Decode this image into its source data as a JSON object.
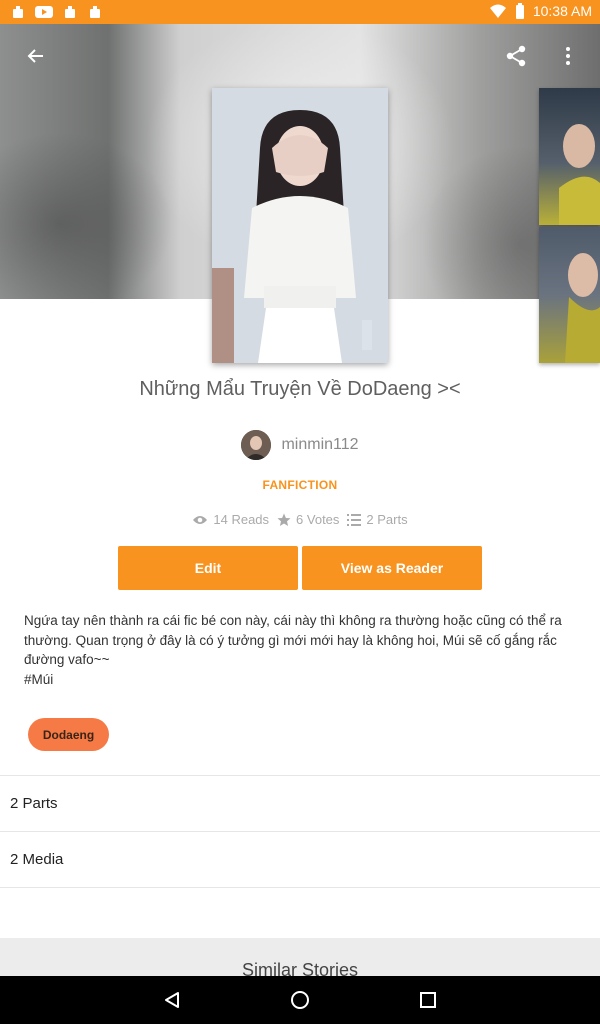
{
  "status_bar": {
    "time": "10:38 AM",
    "left_icons": [
      "notification-icon",
      "youtube-icon",
      "notification-icon",
      "notification-icon"
    ],
    "right_icons": [
      "wifi-icon",
      "battery-icon"
    ]
  },
  "header": {
    "icons": [
      "back-arrow-icon",
      "share-icon",
      "more-vert-icon"
    ]
  },
  "story": {
    "title": "Những Mẩu Truyện Về DoDaeng ><",
    "author": "minmin112",
    "category": "FANFICTION",
    "stats": {
      "reads": "14 Reads",
      "votes": "6 Votes",
      "parts": "2 Parts"
    },
    "actions": {
      "edit": "Edit",
      "view_as_reader": "View as Reader"
    },
    "description_lines": [
      "Ngứa tay nên thành ra cái fic bé con này, cái này thì không ra thường hoặc cũng có thể ra",
      "thường. Quan trọng ở đây là có ý tưởng gì mới mới hay là không hoi, Múi sẽ cố gắng rắc",
      "đường vafo~~",
      "#Múi"
    ],
    "tag": "Dodaeng"
  },
  "sections": {
    "parts": "2 Parts",
    "media": "2 Media",
    "similar": "Similar Stories"
  },
  "colors": {
    "accent": "#f7931e",
    "tag": "#f57a45"
  },
  "nav_bar": {
    "icons": [
      "back-triangle-icon",
      "home-circle-icon",
      "recents-square-icon"
    ]
  }
}
